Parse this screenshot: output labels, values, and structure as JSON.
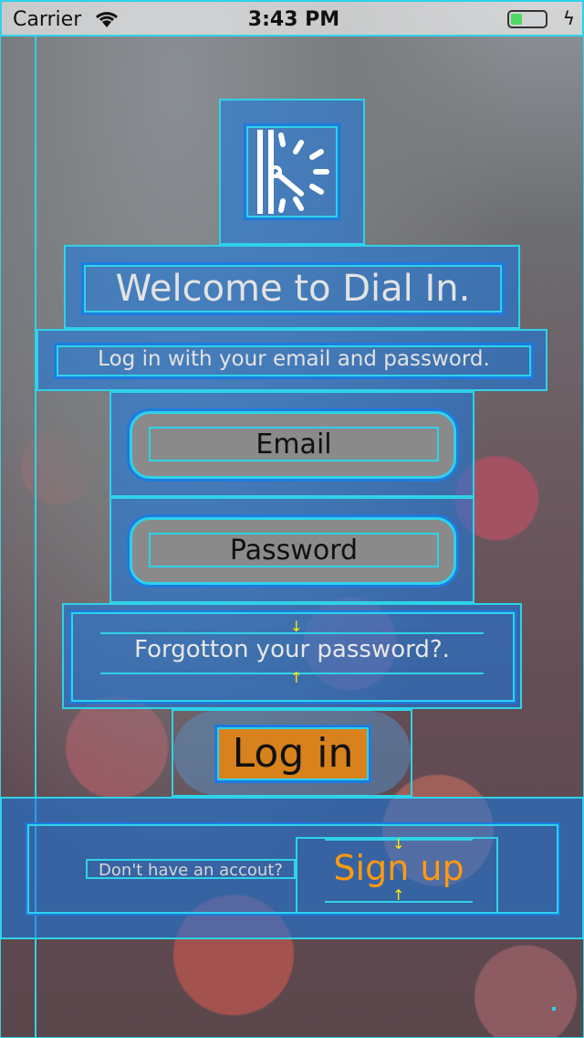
{
  "status_bar": {
    "carrier": "Carrier",
    "time": "3:43 PM"
  },
  "logo": {
    "icon": "dial-clock-icon"
  },
  "header": {
    "title": "Welcome to Dial In.",
    "subtitle": "Log in with your email and password."
  },
  "form": {
    "email_placeholder": "Email",
    "password_placeholder": "Password",
    "forgot_label": "Forgotton your password?.",
    "login_label": "Log in"
  },
  "signup": {
    "prompt": "Don't have an accout?",
    "button_label": "Sign up"
  },
  "colors": {
    "debug_fill": "#1678e6",
    "debug_border": "#2fd2e8",
    "login_button": "#d8821d",
    "signup_text": "#ff9a10"
  }
}
